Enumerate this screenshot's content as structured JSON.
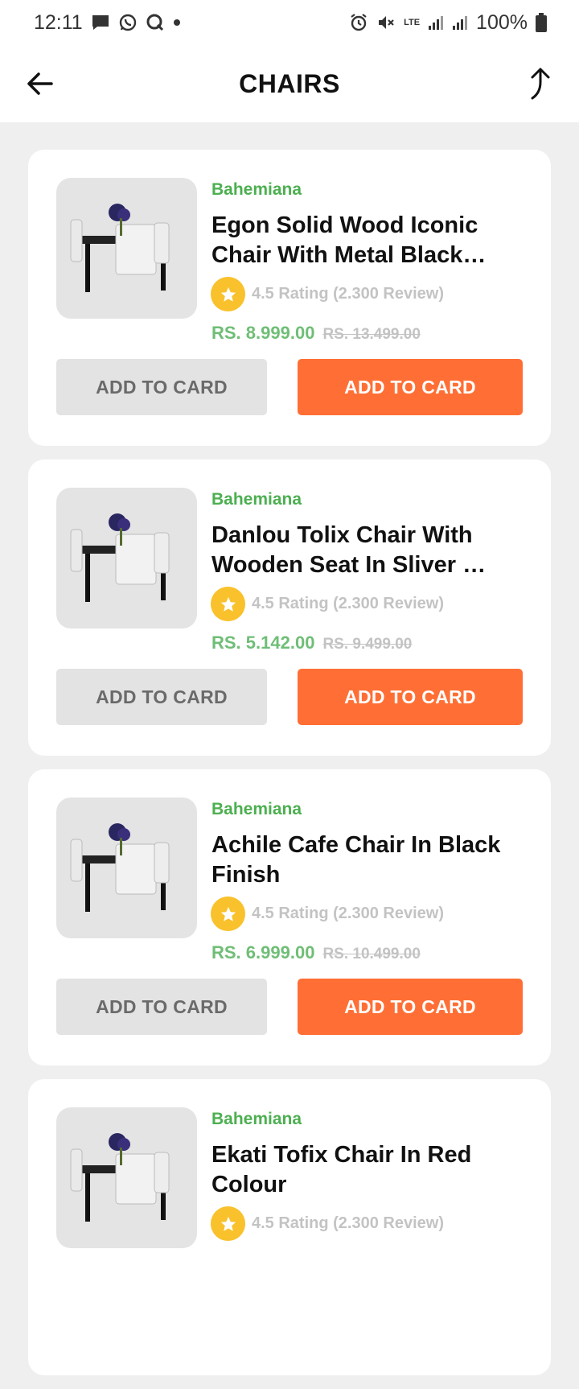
{
  "status": {
    "time": "12:11",
    "network": "LTE",
    "battery": "100%"
  },
  "header": {
    "title": "CHAIRS"
  },
  "colors": {
    "brand_green": "#4caf50",
    "accent_orange": "#ff6f35",
    "star_yellow": "#f9c12b"
  },
  "products": [
    {
      "brand": "Bahemiana",
      "name": "Egon Solid Wood Iconic Chair With Metal Black…",
      "rating": "4.5 Rating (2.300 Review)",
      "price": "RS. 8.999.00",
      "old_price": "RS. 13.499.00",
      "secondary_label": "ADD TO CARD",
      "primary_label": "ADD TO CARD"
    },
    {
      "brand": "Bahemiana",
      "name": "Danlou Tolix Chair With Wooden Seat In Sliver …",
      "rating": "4.5 Rating (2.300 Review)",
      "price": "RS. 5.142.00",
      "old_price": "RS. 9.499.00",
      "secondary_label": "ADD TO CARD",
      "primary_label": "ADD TO CARD"
    },
    {
      "brand": "Bahemiana",
      "name": "Achile Cafe Chair In Black Finish",
      "rating": "4.5 Rating (2.300 Review)",
      "price": "RS. 6.999.00",
      "old_price": "RS. 10.499.00",
      "secondary_label": "ADD TO CARD",
      "primary_label": "ADD TO CARD"
    },
    {
      "brand": "Bahemiana",
      "name": "Ekati  Tofix Chair In Red Colour",
      "rating": "4.5 Rating (2.300 Review)",
      "price": "",
      "old_price": "",
      "secondary_label": "",
      "primary_label": ""
    }
  ]
}
